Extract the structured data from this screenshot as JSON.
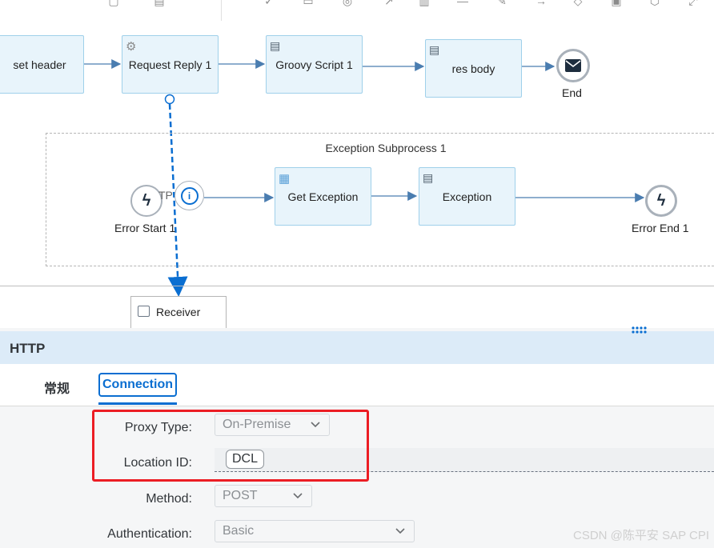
{
  "toolbar": {
    "icons": [
      "copy-icon",
      "paste-icon",
      "check-icon",
      "rectangle-icon",
      "target-icon",
      "arrow-icon",
      "delete-icon",
      "line-icon",
      "edit-icon",
      "arrow-right-icon",
      "diamond-icon",
      "lock-icon",
      "package-icon",
      "expand-icon"
    ]
  },
  "flow": {
    "steps": {
      "set_header": "set header",
      "request_reply": "Request Reply 1",
      "groovy_script": "Groovy Script 1",
      "res_body": "res body",
      "get_exception": "Get Exception",
      "exception": "Exception"
    },
    "end_label": "End",
    "subprocess_title": "Exception Subprocess 1",
    "error_start_label": "Error Start 1",
    "error_end_label": "Error End 1",
    "connector_label": "TP",
    "receiver_label": "Receiver"
  },
  "panel": {
    "title": "HTTP",
    "tabs": {
      "general": "常规",
      "connection": "Connection"
    },
    "fields": {
      "proxy_type_label": "Proxy Type:",
      "proxy_type_value": "On-Premise",
      "location_id_label": "Location ID:",
      "location_id_value": "DCL",
      "method_label": "Method:",
      "method_value": "POST",
      "authentication_label": "Authentication:",
      "authentication_value": "Basic"
    }
  },
  "watermark": "CSDN @陈平安 SAP CPI",
  "colors": {
    "accent": "#0a6ed1",
    "step_fill": "#e8f4fb",
    "step_border": "#9fd0ea",
    "highlight": "#ec1d24"
  }
}
